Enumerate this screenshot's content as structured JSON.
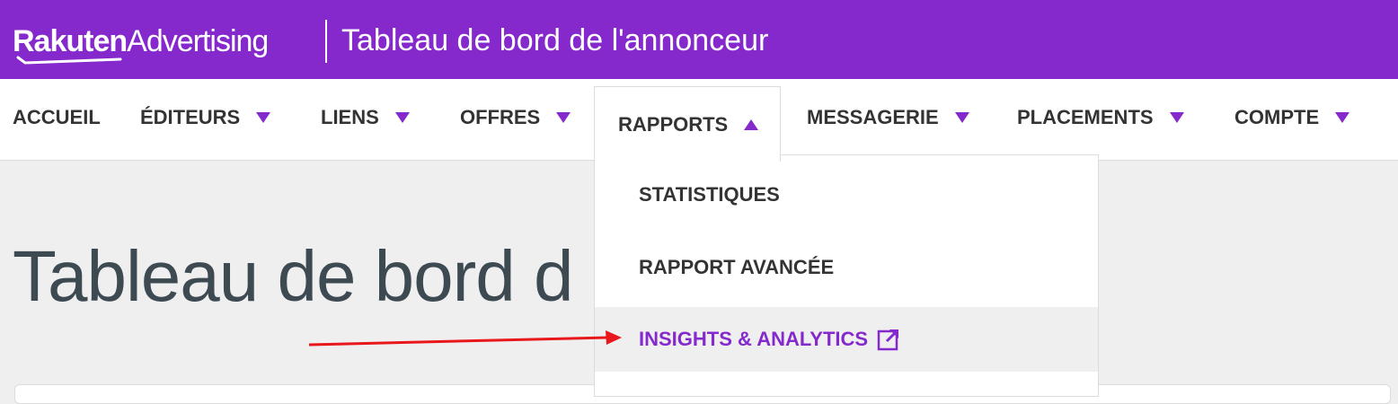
{
  "header": {
    "brand_bold": "Rakuten",
    "brand_light": "Advertising",
    "title": "Tableau de bord de l'annonceur",
    "bg_color": "#8529cd"
  },
  "nav": {
    "items": [
      {
        "label": "ACCUEIL",
        "has_dropdown": false
      },
      {
        "label": "ÉDITEURS",
        "has_dropdown": true
      },
      {
        "label": "LIENS",
        "has_dropdown": true
      },
      {
        "label": "OFFRES",
        "has_dropdown": true
      },
      {
        "label": "RAPPORTS",
        "has_dropdown": true,
        "open": true
      },
      {
        "label": "MESSAGERIE",
        "has_dropdown": true
      },
      {
        "label": "PLACEMENTS",
        "has_dropdown": true
      },
      {
        "label": "COMPTE",
        "has_dropdown": true
      }
    ],
    "accent_color": "#8529cd"
  },
  "dropdown": {
    "items": [
      {
        "label": "STATISTIQUES"
      },
      {
        "label": "RAPPORT AVANCÉE"
      },
      {
        "label": "INSIGHTS & ANALYTICS",
        "icon": "external-link-icon",
        "highlighted": true
      }
    ]
  },
  "page": {
    "heading": "Tableau de bord d"
  },
  "annotation": {
    "arrow_color": "#e8171c"
  }
}
